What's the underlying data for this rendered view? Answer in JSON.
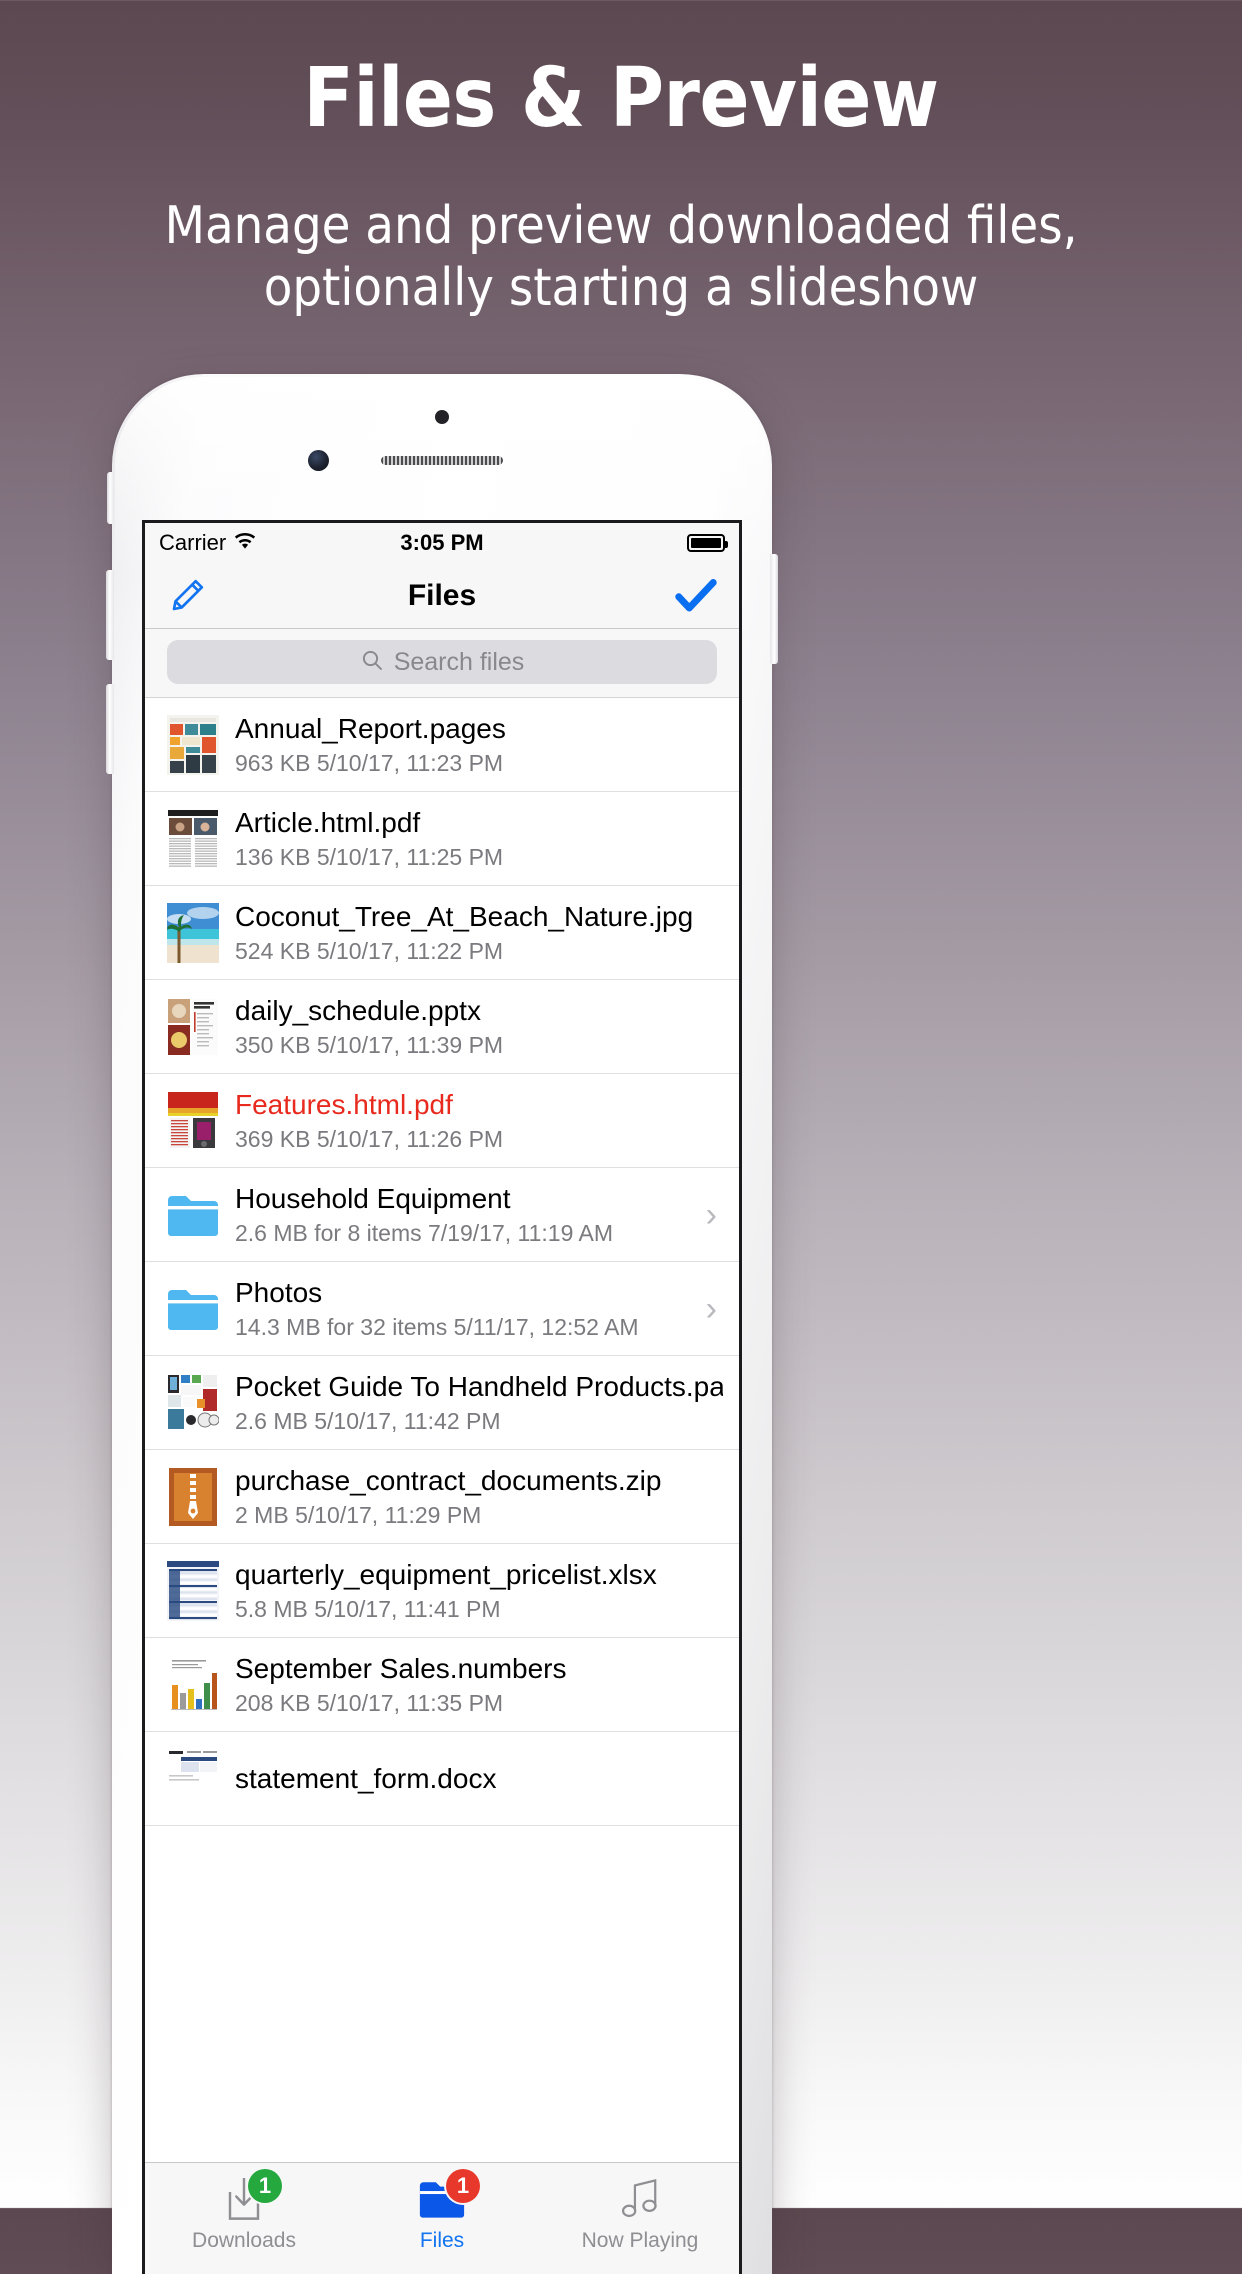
{
  "promo": {
    "title": "Files & Preview",
    "subtitle": "Manage and preview downloaded files, optionally starting a slideshow"
  },
  "colors": {
    "accent_blue": "#1274f0",
    "alert_red": "#e8291d",
    "badge_green": "#25a93f",
    "badge_red": "#e8382c",
    "folder_blue": "#4fb8f0",
    "bg_top": "#5c4850",
    "bg_bottom": "#ffffff"
  },
  "statusbar": {
    "carrier": "Carrier",
    "wifi_icon": "wifi-icon",
    "time": "3:05 PM",
    "battery_icon": "battery-full-icon"
  },
  "navbar": {
    "left_icon": "pencil-edit-icon",
    "title": "Files",
    "right_icon": "checkmark-icon"
  },
  "search": {
    "icon": "search-icon",
    "placeholder": "Search files",
    "value": ""
  },
  "files": [
    {
      "name": "Annual_Report.pages",
      "meta": "963 KB  5/10/17, 11:23 PM",
      "kind": "doc",
      "thumb": "infographic-thumbnail",
      "red": false,
      "chevron": false
    },
    {
      "name": "Article.html.pdf",
      "meta": "136 KB  5/10/17, 11:25 PM",
      "kind": "doc",
      "thumb": "news-article-thumbnail",
      "red": false,
      "chevron": false
    },
    {
      "name": "Coconut_Tree_At_Beach_Nature.jpg",
      "meta": "524 KB  5/10/17, 11:22 PM",
      "kind": "image",
      "thumb": "beach-photo-thumbnail",
      "red": false,
      "chevron": false
    },
    {
      "name": "daily_schedule.pptx",
      "meta": "350 KB  5/10/17, 11:39 PM",
      "kind": "doc",
      "thumb": "presentation-thumbnail",
      "red": false,
      "chevron": false
    },
    {
      "name": "Features.html.pdf",
      "meta": "369 KB  5/10/17, 11:26 PM",
      "kind": "doc",
      "thumb": "brochure-thumbnail",
      "red": true,
      "chevron": false
    },
    {
      "name": "Household Equipment",
      "meta": "2.6 MB for 8 items  7/19/17, 11:19 AM",
      "kind": "folder",
      "thumb": "folder-icon",
      "red": false,
      "chevron": true
    },
    {
      "name": "Photos",
      "meta": "14.3 MB for 32 items  5/11/17, 12:52 AM",
      "kind": "folder",
      "thumb": "folder-icon",
      "red": false,
      "chevron": true
    },
    {
      "name": "Pocket Guide To Handheld Products.pages",
      "meta": "2.6 MB  5/10/17, 11:42 PM",
      "kind": "doc",
      "thumb": "product-grid-thumbnail",
      "red": false,
      "chevron": false
    },
    {
      "name": "purchase_contract_documents.zip",
      "meta": "2 MB  5/10/17, 11:29 PM",
      "kind": "archive",
      "thumb": "zip-archive-icon",
      "red": false,
      "chevron": false
    },
    {
      "name": "quarterly_equipment_pricelist.xlsx",
      "meta": "5.8 MB  5/10/17, 11:41 PM",
      "kind": "doc",
      "thumb": "spreadsheet-thumbnail",
      "red": false,
      "chevron": false
    },
    {
      "name": "September Sales.numbers",
      "meta": "208 KB  5/10/17, 11:35 PM",
      "kind": "doc",
      "thumb": "bar-chart-thumbnail",
      "red": false,
      "chevron": false
    },
    {
      "name": "statement_form.docx",
      "meta": "",
      "kind": "doc",
      "thumb": "form-document-thumbnail",
      "red": false,
      "chevron": false
    }
  ],
  "tabbar": {
    "tabs": [
      {
        "label": "Downloads",
        "icon": "download-icon",
        "badge": "1",
        "badge_color": "green",
        "active": false
      },
      {
        "label": "Files",
        "icon": "folder-icon",
        "badge": "1",
        "badge_color": "red",
        "active": true
      },
      {
        "label": "Now Playing",
        "icon": "music-note-icon",
        "badge": "",
        "badge_color": "",
        "active": false
      }
    ]
  }
}
